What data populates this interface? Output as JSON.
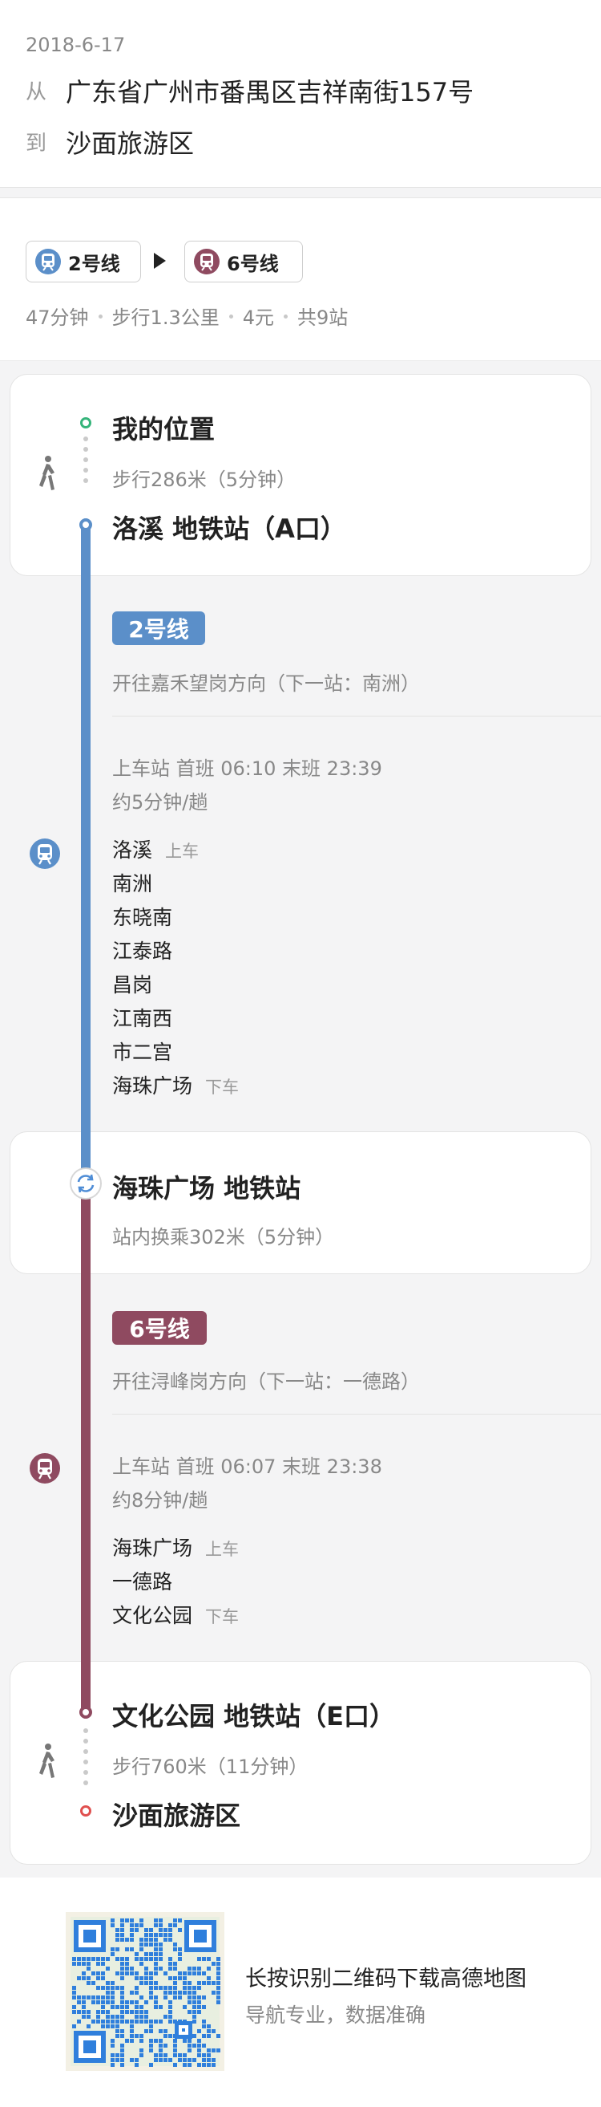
{
  "header": {
    "date": "2018-6-17",
    "from_label": "从",
    "from": "广东省广州市番禺区吉祥南街157号",
    "to_label": "到",
    "to": "沙面旅游区"
  },
  "summary": {
    "lines": [
      {
        "label": "2号线",
        "color": "#5b8fc9",
        "icon": "metro-icon"
      },
      {
        "label": "6号线",
        "color": "#8f4a60",
        "icon": "metro-icon"
      }
    ],
    "duration": "47分钟",
    "walk": "步行1.3公里",
    "fare": "4元",
    "stops": "共9站"
  },
  "start": {
    "title": "我的位置",
    "walk": "步行286米（5分钟）",
    "station": "洛溪 地铁站（A口）"
  },
  "leg1": {
    "line": "2号线",
    "color": "#5b8fc9",
    "direction": "开往嘉禾望岗方向（下一站：南洲）",
    "times": "上车站 首班 06:10  末班 23:39",
    "frequency": "约5分钟/趟",
    "stations": [
      "洛溪",
      "南洲",
      "东晓南",
      "江泰路",
      "昌岗",
      "江南西",
      "市二宫",
      "海珠广场"
    ],
    "board_label": "上车",
    "alight_label": "下车"
  },
  "transfer": {
    "title": "海珠广场 地铁站",
    "note": "站内换乘302米（5分钟）",
    "icon": "transfer-icon"
  },
  "leg2": {
    "line": "6号线",
    "color": "#8f4a60",
    "direction": "开往浔峰岗方向（下一站：一德路）",
    "times": "上车站 首班 06:07  末班 23:38",
    "frequency": "约8分钟/趟",
    "stations": [
      "海珠广场",
      "一德路",
      "文化公园"
    ],
    "board_label": "上车",
    "alight_label": "下车"
  },
  "end": {
    "station": "文化公园 地铁站（E口）",
    "walk": "步行760米（11分钟）",
    "title": "沙面旅游区"
  },
  "footer": {
    "title": "长按识别二维码下载高德地图",
    "subtitle": "导航专业，数据准确"
  }
}
